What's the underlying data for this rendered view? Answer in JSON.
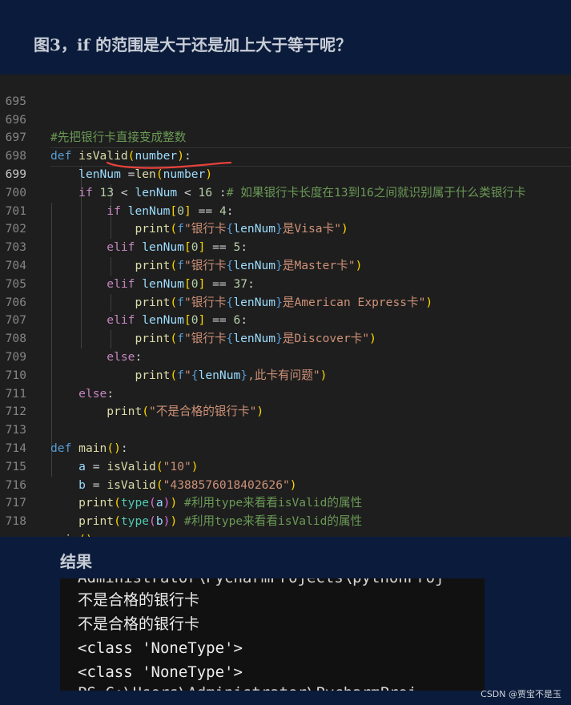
{
  "heading": "图3，if 的范围是大于还是加上大于等于呢？",
  "editor": {
    "lines": [
      {
        "num": "695"
      },
      {
        "num": "696",
        "comment": "#先把银行卡直接变成整数"
      },
      {
        "num": "697",
        "kw": "def",
        "fname": "isValid",
        "param": "number"
      },
      {
        "num": "698",
        "var": "lenNum",
        "op": " =",
        "fn": "len",
        "arg": "number"
      },
      {
        "num": "699",
        "kw": "if",
        "lo": "13",
        "var": "lenNum",
        "hi": "16",
        "comment": "# 如果银行卡长度在13到16之间就识别属于什么类银行卡"
      },
      {
        "num": "700",
        "kw": "if",
        "var": "lenNum",
        "idx": "0",
        "val": "4"
      },
      {
        "num": "701",
        "fn": "print",
        "pre": "f",
        "s1": "\"银行卡",
        "var": "lenNum",
        "s2": "是Visa卡\""
      },
      {
        "num": "702",
        "kw": "elif",
        "var": "lenNum",
        "idx": "0",
        "val": "5"
      },
      {
        "num": "703",
        "fn": "print",
        "pre": "f",
        "s1": "\"银行卡",
        "var": "lenNum",
        "s2": "是Master卡\""
      },
      {
        "num": "704",
        "kw": "elif",
        "var": "lenNum",
        "idx": "0",
        "val": "37"
      },
      {
        "num": "705",
        "fn": "print",
        "pre": "f",
        "s1": "\"银行卡",
        "var": "lenNum",
        "s2": "是American Express卡\""
      },
      {
        "num": "706",
        "kw": "elif",
        "var": "lenNum",
        "idx": "0",
        "val": "6"
      },
      {
        "num": "707",
        "fn": "print",
        "pre": "f",
        "s1": "\"银行卡",
        "var": "lenNum",
        "s2": "是Discover卡\""
      },
      {
        "num": "708",
        "kw": "else"
      },
      {
        "num": "709",
        "fn": "print",
        "pre": "f",
        "s1": "\"",
        "var": "lenNum",
        "s2": ",此卡有问题\""
      },
      {
        "num": "710",
        "kw": "else"
      },
      {
        "num": "711",
        "fn": "print",
        "str": "\"不是合格的银行卡\""
      },
      {
        "num": "712"
      },
      {
        "num": "713",
        "kw": "def",
        "fname": "main"
      },
      {
        "num": "714",
        "var": "a",
        "fn": "isValid",
        "str": "\"10\""
      },
      {
        "num": "715",
        "var": "b",
        "fn": "isValid",
        "str": "\"4388576018402626\""
      },
      {
        "num": "716",
        "fn": "print",
        "type": "type",
        "arg": "a",
        "comment": "#利用type来看看isValid的属性"
      },
      {
        "num": "717",
        "fn": "print",
        "type": "type",
        "arg": "b",
        "comment": "#利用type来看看isValid的属性"
      },
      {
        "num": "718",
        "fn": "main"
      }
    ]
  },
  "result": {
    "title": "结果",
    "terminal_lines": [
      "Administrator\\PycharmProjects\\pythonProj",
      "不是合格的银行卡",
      "不是合格的银行卡",
      "<class 'NoneType'>",
      "<class 'NoneType'>",
      "PS C:\\Users\\Administrator\\PycharmProj"
    ]
  },
  "watermark": "CSDN @贾宝不是玉",
  "colors": {
    "page_bg": "#0b1b3b",
    "editor_bg": "#1e1e1e",
    "terminal_bg": "#111111",
    "annotation": "#e8423b"
  }
}
